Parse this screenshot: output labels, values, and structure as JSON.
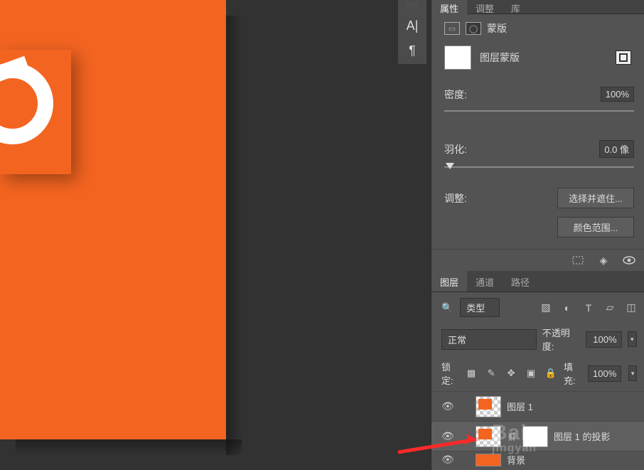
{
  "canvas": {
    "bg": "#323232",
    "shape_color": "#F36421"
  },
  "text_tool": {
    "glyph_a": "A|",
    "glyph_p": "¶"
  },
  "properties": {
    "tabs": {
      "props": "属性",
      "adjust": "调整",
      "lib": "库"
    },
    "mask_title": "蒙版",
    "layer_mask": "图层蒙版",
    "density_label": "密度:",
    "density_value": "100%",
    "feather_label": "羽化:",
    "feather_value": "0.0 像",
    "adjust_label": "调整:",
    "select_hide": "选择并遮住...",
    "color_range": "颜色范围..."
  },
  "layers_panel": {
    "tabs": {
      "layers": "图层",
      "channels": "通道",
      "paths": "路径"
    },
    "type_filter": "类型",
    "blend_mode": "正常",
    "opacity_label": "不透明度:",
    "opacity_value": "100%",
    "lock_label": "锁定:",
    "fill_label": "填充:",
    "fill_value": "100%",
    "layers": [
      {
        "name": "图层 1"
      },
      {
        "name": "图层 1 的投影"
      },
      {
        "name": "背景"
      }
    ]
  },
  "watermark": {
    "brand": "Bai",
    "sub": "jingyan"
  }
}
